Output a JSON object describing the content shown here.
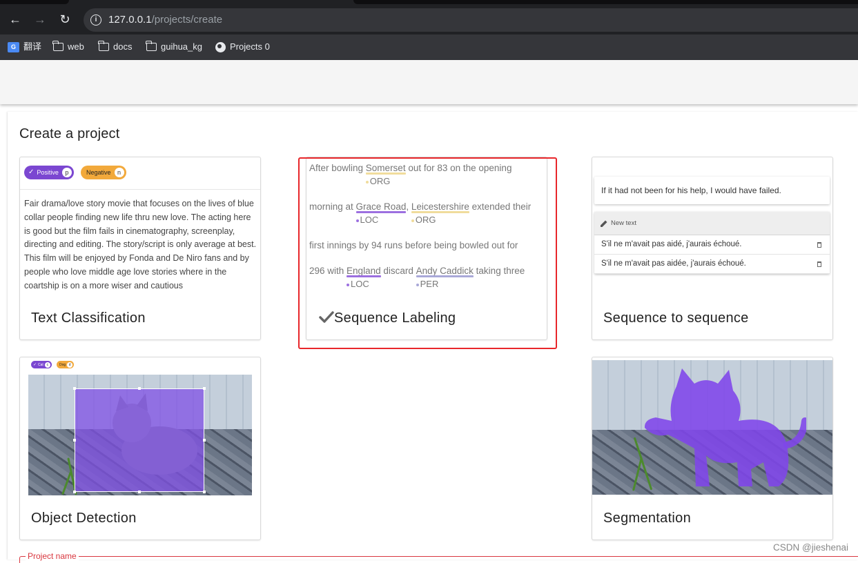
{
  "browser": {
    "url_host": "127.0.0.1",
    "url_path": "/projects/create",
    "bookmarks": [
      {
        "label": "翻译",
        "icon": "translate-icon"
      },
      {
        "label": "web",
        "icon": "folder-icon"
      },
      {
        "label": "docs",
        "icon": "folder-icon"
      },
      {
        "label": "guihua_kg",
        "icon": "folder-icon"
      },
      {
        "label": "Projects 0",
        "icon": "globe-icon"
      }
    ]
  },
  "page": {
    "title": "Create a project"
  },
  "cards": {
    "text_classification": {
      "title": "Text Classification",
      "chips": [
        {
          "label": "Positive",
          "key": "p"
        },
        {
          "label": "Negative",
          "key": "n"
        }
      ],
      "text": "Fair drama/love story movie that focuses on the lives of blue collar people finding new life thru new love. The acting here is good but the film fails in cinematography, screenplay, directing and editing. The story/script is only average at best. This film will be enjoyed by Fonda and De Niro fans and by people who love middle age love stories where in the coartship is on a more wiser and cautious"
    },
    "sequence_labeling": {
      "title": "Sequence Labeling",
      "line1": {
        "pre": "After bowling ",
        "e1": "Somerset",
        "post": " out for 83 on the opening",
        "l1": "ORG"
      },
      "line2": {
        "pre": "morning at ",
        "e1": "Grace Road",
        "mid": ", ",
        "e2": "Leicestershire",
        "post": " extended their",
        "l1": "LOC",
        "l2": "ORG"
      },
      "line3": {
        "text": "first innings by 94 runs before being bowled out for"
      },
      "line4": {
        "pre": "296 with ",
        "e1": "England",
        "mid": " discard ",
        "e2": "Andy Caddick",
        "post": " taking three",
        "l1": "LOC",
        "l2": "PER"
      }
    },
    "seq2seq": {
      "title": "Sequence to sequence",
      "source": "If it had not been for his help, I would have failed.",
      "new_text_label": "New text",
      "translations": [
        "S'il ne m'avait pas aidé, j'aurais échoué.",
        "S'il ne m'avait pas aidée, j'aurais échoué."
      ]
    },
    "object_detection": {
      "title": "Object Detection",
      "chips": [
        {
          "label": "Cat",
          "key": "c"
        },
        {
          "label": "Dog",
          "key": "d"
        }
      ]
    },
    "segmentation": {
      "title": "Segmentation"
    }
  },
  "form": {
    "project_name_label": "Project name"
  },
  "watermark": "CSDN @jieshenai",
  "colors": {
    "positive": "#7b47d1",
    "negative": "#f2a93b",
    "org": "#f0dc9c",
    "loc": "#9c6fe0",
    "per": "#a9a8d8",
    "highlight_box": "#e8262a"
  }
}
